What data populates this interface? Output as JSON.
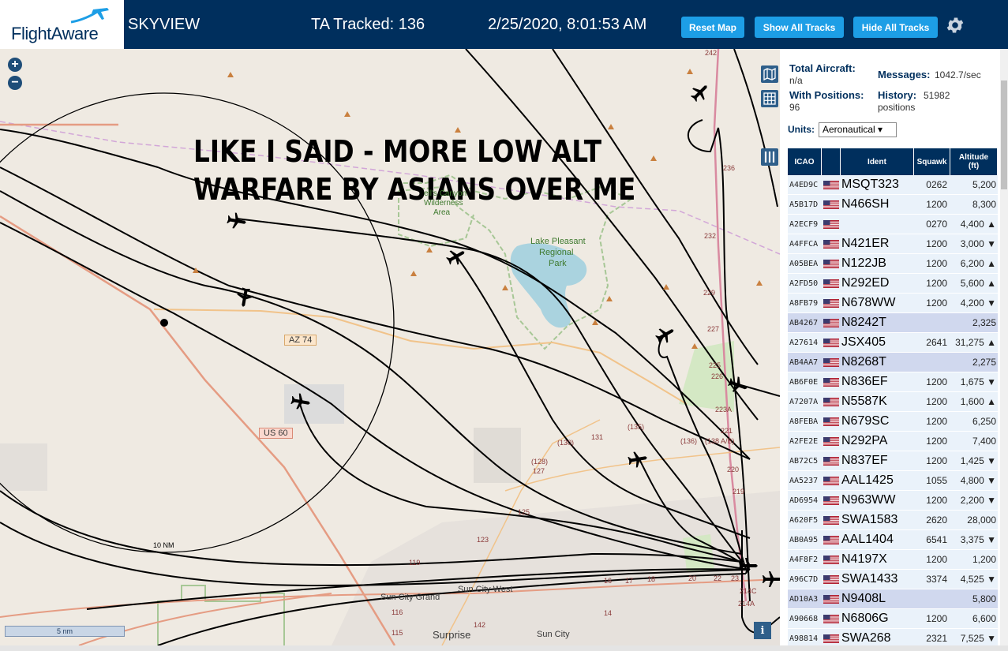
{
  "header": {
    "logo_text": "FlightAware",
    "app_title": "SKYVIEW",
    "tracked": "TA Tracked: 136",
    "datetime": "2/25/2020, 8:01:53 AM",
    "buttons": {
      "reset": "Reset Map",
      "show_all": "Show All Tracks",
      "hide_all": "Hide All Tracks"
    },
    "icons": {
      "settings": "gear-icon",
      "logo": "plane-logo-icon"
    }
  },
  "map": {
    "overlay_text_line1": "LIKE I SAID - MORE LOW ALT",
    "overlay_text_line2": "WARFARE BY ASIANS OVER ME",
    "labels": {
      "wilderness": "Hell's Canyon Wilderness Area",
      "wilderness_short1": "ell's Canyon",
      "wilderness_short2": "Wilderness",
      "wilderness_short3": "Area",
      "lake1": "Lake Pleasant",
      "lake2": "Regional",
      "lake3": "Park",
      "az74": "AZ 74",
      "us60": "US 60",
      "range": "10 NM",
      "sun_city_grand": "Sun City Grand",
      "sun_city_west": "Sun City West",
      "sun_city": "Sun City",
      "surprise": "Surprise",
      "r131": "131",
      "r135": "(135)",
      "r130": "(130)",
      "r128": "(128)",
      "r127": "127",
      "r125": "125",
      "r123": "123",
      "r119": "119",
      "r116": "116",
      "r115": "115",
      "r142": "142",
      "r136": "(136)",
      "r138": "(138 A/B)",
      "r221": "221",
      "r220": "220",
      "r219": "219",
      "r223a": "223A",
      "r225": "225",
      "r226": "226",
      "r227": "227",
      "r229": "229",
      "r232": "232",
      "r236": "236",
      "r242": "242",
      "r214c": "214C",
      "r214a": "214A",
      "r16": "16",
      "r17": "17",
      "r18": "18",
      "r20": "20",
      "r22": "22",
      "r23": "23",
      "r14": "14"
    },
    "scale_label": "5 nm",
    "controls": {
      "zoom_in": "+",
      "zoom_out": "−",
      "info": "i"
    },
    "colors": {
      "land": "#efeae2",
      "water": "#aad3df",
      "track": "#000000"
    }
  },
  "sidebar": {
    "total_aircraft_label": "Total Aircraft:",
    "total_aircraft_value": "n/a",
    "with_positions_label": "With Positions:",
    "with_positions_value": "96",
    "messages_label": "Messages:",
    "messages_value": "1042.7/sec",
    "history_label": "History:",
    "history_value": "51982",
    "history_unit": "positions",
    "units_label": "Units:",
    "units_value": "Aeronautical ▾",
    "table": {
      "headers": [
        "ICAO",
        "",
        "Ident",
        "Squawk",
        "Altitude (ft)"
      ],
      "rows": [
        {
          "icao": "A4ED9C",
          "ident": "MSQT323",
          "squawk": "0262",
          "alt": "5,200",
          "hl": false
        },
        {
          "icao": "A5B17D",
          "ident": "N466SH",
          "squawk": "1200",
          "alt": "8,300",
          "hl": false
        },
        {
          "icao": "A2ECF9",
          "ident": "",
          "squawk": "0270",
          "alt": "4,400 ▲",
          "hl": false
        },
        {
          "icao": "A4FFCA",
          "ident": "N421ER",
          "squawk": "1200",
          "alt": "3,000 ▼",
          "hl": false
        },
        {
          "icao": "A05BEA",
          "ident": "N122JB",
          "squawk": "1200",
          "alt": "6,200 ▲",
          "hl": false
        },
        {
          "icao": "A2FD50",
          "ident": "N292ED",
          "squawk": "1200",
          "alt": "5,600 ▲",
          "hl": false
        },
        {
          "icao": "A8FB79",
          "ident": "N678WW",
          "squawk": "1200",
          "alt": "4,200 ▼",
          "hl": false
        },
        {
          "icao": "AB4267",
          "ident": "N8242T",
          "squawk": "",
          "alt": "2,325",
          "hl": true
        },
        {
          "icao": "A27614",
          "ident": "JSX405",
          "squawk": "2641",
          "alt": "31,275 ▲",
          "hl": false
        },
        {
          "icao": "AB4AA7",
          "ident": "N8268T",
          "squawk": "",
          "alt": "2,275",
          "hl": true
        },
        {
          "icao": "AB6F0E",
          "ident": "N836EF",
          "squawk": "1200",
          "alt": "1,675 ▼",
          "hl": false
        },
        {
          "icao": "A7207A",
          "ident": "N5587K",
          "squawk": "1200",
          "alt": "1,600 ▲",
          "hl": false
        },
        {
          "icao": "A8FEBA",
          "ident": "N679SC",
          "squawk": "1200",
          "alt": "6,250",
          "hl": false
        },
        {
          "icao": "A2FE2E",
          "ident": "N292PA",
          "squawk": "1200",
          "alt": "7,400",
          "hl": false
        },
        {
          "icao": "AB72C5",
          "ident": "N837EF",
          "squawk": "1200",
          "alt": "1,425 ▼",
          "hl": false
        },
        {
          "icao": "AA5237",
          "ident": "AAL1425",
          "squawk": "1055",
          "alt": "4,800 ▼",
          "hl": false
        },
        {
          "icao": "AD6954",
          "ident": "N963WW",
          "squawk": "1200",
          "alt": "2,200 ▼",
          "hl": false
        },
        {
          "icao": "A620F5",
          "ident": "SWA1583",
          "squawk": "2620",
          "alt": "28,000",
          "hl": false
        },
        {
          "icao": "AB0A95",
          "ident": "AAL1404",
          "squawk": "6541",
          "alt": "3,375 ▼",
          "hl": false
        },
        {
          "icao": "A4F8F2",
          "ident": "N4197X",
          "squawk": "1200",
          "alt": "1,200",
          "hl": false
        },
        {
          "icao": "A96C7D",
          "ident": "SWA1433",
          "squawk": "3374",
          "alt": "4,525 ▼",
          "hl": false
        },
        {
          "icao": "AD10A3",
          "ident": "N9408L",
          "squawk": "",
          "alt": "5,800",
          "hl": true
        },
        {
          "icao": "A90668",
          "ident": "N6806G",
          "squawk": "1200",
          "alt": "6,600",
          "hl": false
        },
        {
          "icao": "A98814",
          "ident": "SWA268",
          "squawk": "2321",
          "alt": "7,525 ▼",
          "hl": false
        }
      ]
    }
  }
}
